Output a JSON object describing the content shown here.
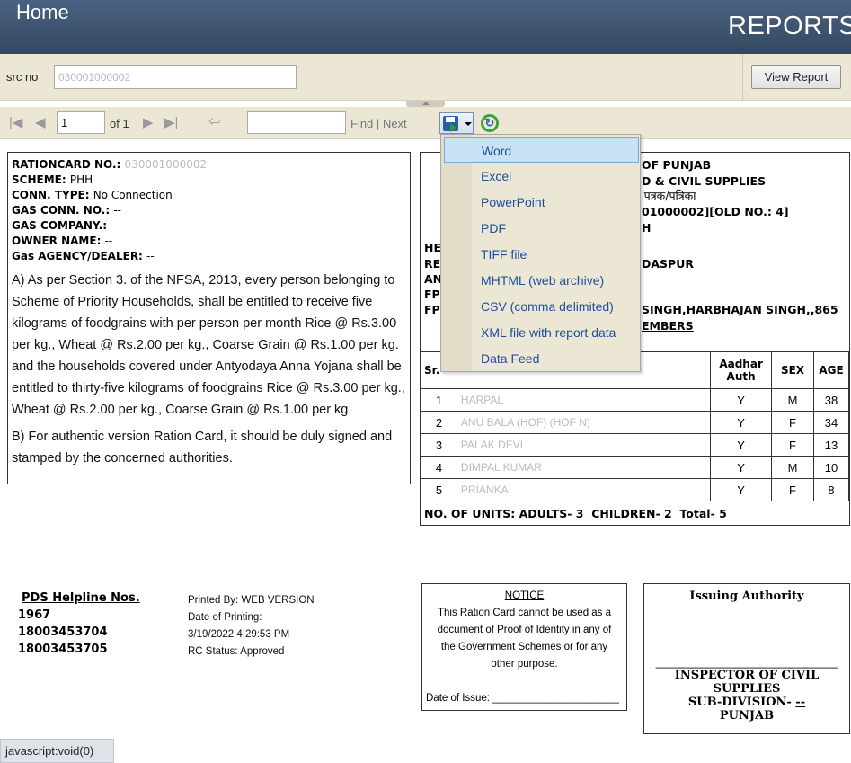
{
  "header": {
    "home": "Home",
    "title": "REPORTS"
  },
  "params": {
    "label": "src no",
    "value": "030001000002",
    "view_button": "View Report"
  },
  "toolbar": {
    "page": "1",
    "of": "of 1",
    "find": "Find",
    "sep": "|",
    "next": "Next"
  },
  "export_menu": [
    "Word",
    "Excel",
    "PowerPoint",
    "PDF",
    "TIFF file",
    "MHTML (web archive)",
    "CSV (comma delimited)",
    "XML file with report data",
    "Data Feed"
  ],
  "left": {
    "fields": [
      {
        "k": "RATIONCARD NO.:",
        "v": "030001000002"
      },
      {
        "k": "SCHEME:",
        "v": "PHH"
      },
      {
        "k": "CONN. TYPE:",
        "v": "No Connection"
      },
      {
        "k": "GAS CONN. NO.:",
        "v": "--"
      },
      {
        "k": "GAS COMPANY.:",
        "v": "--"
      },
      {
        "k": "OWNER NAME:",
        "v": "--"
      },
      {
        "k": "Gas AGENCY/DEALER:",
        "v": "--"
      }
    ],
    "para_a": "A) As per Section 3. of the NFSA, 2013, every person belonging to Scheme of Priority Households, shall be entitled to receive five kilograms of foodgrains with per person per month  Rice @ Rs.3.00 per kg., Wheat @ Rs.2.00 per kg., Coarse Grain @ Rs.1.00 per kg. and the households covered under Antyodaya Anna Yojana shall be entitled to thirty-five kilograms of foodgrains Rice @ Rs.3.00 per kg., Wheat @ Rs.2.00 per kg., Coarse Grain @ Rs.1.00 per kg.",
    "para_b": "B) For authentic version Ration Card, it should be duly signed and stamped by the concerned authorities."
  },
  "right": {
    "l1": "OF PUNJAB",
    "l2": "D & CIVIL SUPPLIES",
    "l3": "ा पत्रक/पत्रिका",
    "l4": "01000002][OLD NO.: 4]",
    "l5": "H",
    "he": "HE",
    "re": "RE",
    "an": "AN",
    "fp1": "FP",
    "fp2": "FP",
    "l6": "DASPUR",
    "l7": "SINGH,HARBHAJAN SINGH,,865",
    "l8": "EMBERS",
    "table": {
      "headers": {
        "sr": "Sr.",
        "aadhar": "Aadhar Auth",
        "sex": "SEX",
        "age": "AGE"
      },
      "rows": [
        {
          "sr": "1",
          "name": "HARPAL",
          "aadhar": "Y",
          "sex": "M",
          "age": "38"
        },
        {
          "sr": "2",
          "name": "ANU BALA  (HOF) (HOF N)",
          "aadhar": "Y",
          "sex": "F",
          "age": "34"
        },
        {
          "sr": "3",
          "name": "PALAK DEVI",
          "aadhar": "Y",
          "sex": "F",
          "age": "13"
        },
        {
          "sr": "4",
          "name": "DIMPAL KUMAR",
          "aadhar": "Y",
          "sex": "M",
          "age": "10"
        },
        {
          "sr": "5",
          "name": "PRIANKA",
          "aadhar": "Y",
          "sex": "F",
          "age": "8"
        }
      ]
    },
    "units": {
      "label": "NO. OF UNITS",
      "adults_label": ": ADULTS-",
      "adults": "3",
      "children_label": "CHILDREN-",
      "children": "2",
      "total_label": "Total-",
      "total": "5"
    }
  },
  "footer": {
    "helpline_title": "PDS Helpline Nos.",
    "helplines": [
      "1967",
      "18003453704",
      "18003453705"
    ],
    "printed": [
      "Printed By:  WEB VERSION",
      "Date of Printing:",
      "3/19/2022 4:29:53 PM",
      "RC Status: Approved"
    ],
    "notice_title": "NOTICE",
    "notice_text": "This Ration Card cannot be used as a document of Proof of Identity in any of the Government Schemes or for any other purpose.",
    "date_issue": "Date of Issue: ______________________",
    "issuing_title": "Issuing Authority",
    "issuing_line": "____________________________",
    "inspector": "INSPECTOR OF CIVIL SUPPLIES",
    "subdiv": "SUB-DIVISION- ",
    "subdiv_val": "--",
    "state": "PUNJAB"
  },
  "statusbar": "javascript:void(0)"
}
